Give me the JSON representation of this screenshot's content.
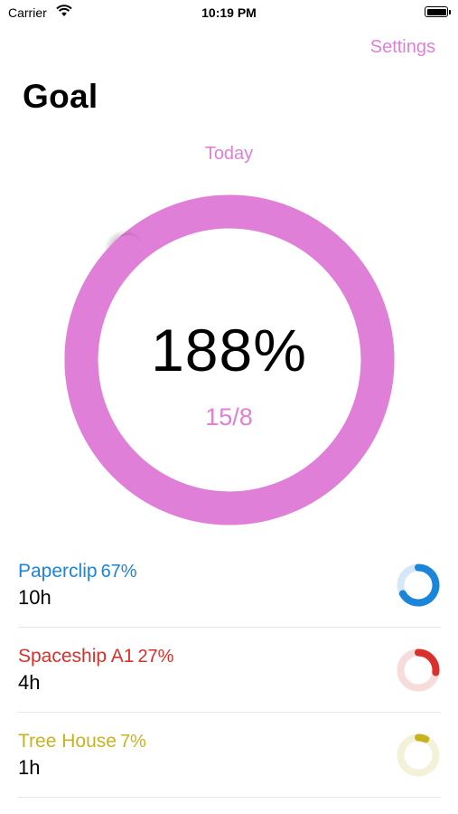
{
  "status": {
    "carrier": "Carrier",
    "time": "10:19 PM"
  },
  "nav": {
    "settings_label": "Settings"
  },
  "header": {
    "title": "Goal"
  },
  "summary": {
    "period": "Today",
    "percent_text": "188%",
    "fraction_text": "15/8",
    "progress": 1.88,
    "accent_color": "#e07fd8",
    "track_color": "#e07fd8"
  },
  "projects": [
    {
      "name": "Paperclip",
      "percent": "67%",
      "hours": "10h",
      "progress": 0.67,
      "color": "#1a85d9",
      "track": "#d6e8f8"
    },
    {
      "name": "Spaceship A1",
      "percent": "27%",
      "hours": "4h",
      "progress": 0.27,
      "color": "#d9302c",
      "track": "#f8dcdc"
    },
    {
      "name": "Tree House",
      "percent": "7%",
      "hours": "1h",
      "progress": 0.07,
      "color": "#c9b222",
      "track": "#f3f1d8"
    }
  ]
}
